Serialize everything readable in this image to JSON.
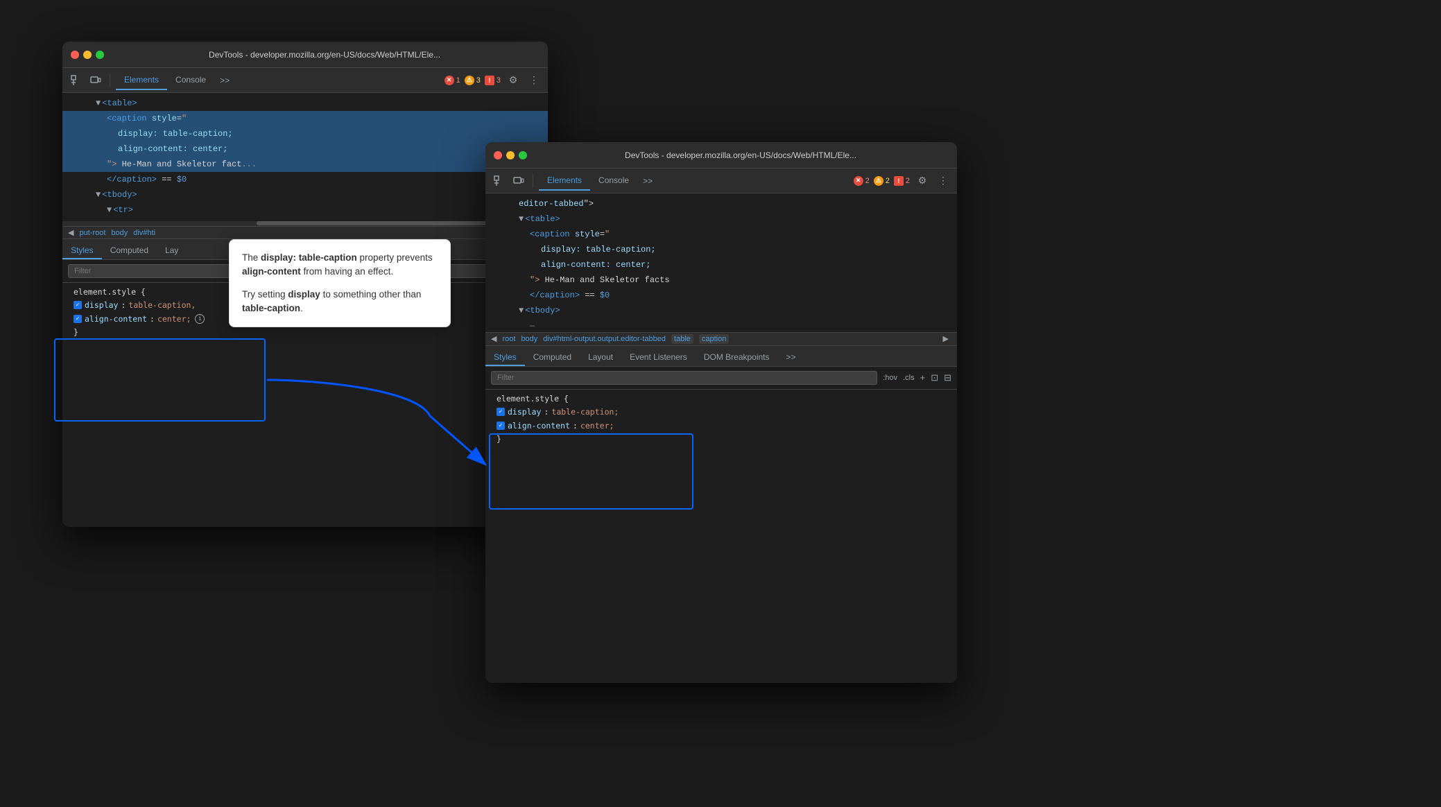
{
  "window1": {
    "title": "DevTools - developer.mozilla.org/en-US/docs/Web/HTML/Ele...",
    "tabs": [
      "Elements",
      "Console"
    ],
    "active_tab": "Elements",
    "badges": [
      {
        "type": "error",
        "count": "1"
      },
      {
        "type": "warning",
        "count": "3"
      },
      {
        "type": "info",
        "count": "3"
      }
    ],
    "html_lines": [
      {
        "indent": 2,
        "content": "▼<table>",
        "selected": false
      },
      {
        "indent": 3,
        "content": "<caption style=\"",
        "selected": true
      },
      {
        "indent": 4,
        "content": "display: table-caption;",
        "selected": true
      },
      {
        "indent": 4,
        "content": "align-content: center;",
        "selected": true
      },
      {
        "indent": 3,
        "content": "\"> He-Man and Skeletor facts",
        "selected": true
      },
      {
        "indent": 3,
        "content": "</caption> == $0",
        "selected": false
      },
      {
        "indent": 2,
        "content": "▼<tbody>",
        "selected": false
      },
      {
        "indent": 3,
        "content": "▼<tr>",
        "selected": false
      }
    ],
    "breadcrumb": [
      "◀",
      "put-root",
      "body",
      "div#hti"
    ],
    "styles_tabs": [
      "Styles",
      "Computed",
      "Lay"
    ],
    "filter_placeholder": "Filter",
    "css_rule": {
      "selector": "element.style {",
      "properties": [
        {
          "checked": true,
          "prop": "display",
          "value": "table-caption,"
        },
        {
          "checked": true,
          "prop": "align-content",
          "value": "center;"
        }
      ],
      "close": "}"
    }
  },
  "window2": {
    "title": "DevTools - developer.mozilla.org/en-US/docs/Web/HTML/Ele...",
    "tabs": [
      "Elements",
      "Console"
    ],
    "active_tab": "Elements",
    "badges": [
      {
        "type": "error",
        "count": "2"
      },
      {
        "type": "warning",
        "count": "2"
      },
      {
        "type": "info",
        "count": "2"
      }
    ],
    "html_lines": [
      {
        "indent": 2,
        "content": "editor-tabbed\">"
      },
      {
        "indent": 2,
        "content": "▼<table>"
      },
      {
        "indent": 3,
        "content": "<caption style=\""
      },
      {
        "indent": 4,
        "content": "display: table-caption;"
      },
      {
        "indent": 4,
        "content": "align-content: center;"
      },
      {
        "indent": 3,
        "content": "\"> He-Man and Skeletor facts"
      },
      {
        "indent": 3,
        "content": "</caption> == $0"
      },
      {
        "indent": 2,
        "content": "▼<tbody>"
      },
      {
        "indent": 3,
        "content": "—"
      }
    ],
    "breadcrumb": [
      "◀",
      "root",
      "body",
      "div#html-output.output.editor-tabbed",
      "table",
      "caption"
    ],
    "styles_tabs": [
      "Styles",
      "Computed",
      "Layout",
      "Event Listeners",
      "DOM Breakpoints",
      ">>"
    ],
    "active_styles_tab": "Styles",
    "filter_placeholder": "Filter",
    "filter_toolbar": [
      ":hov",
      ".cls",
      "+",
      "⊡",
      "⊟"
    ],
    "css_rule": {
      "selector": "element.style {",
      "properties": [
        {
          "checked": true,
          "prop": "display",
          "value": "table-caption;"
        },
        {
          "checked": true,
          "prop": "align-content",
          "value": "center;"
        }
      ],
      "close": "}"
    }
  },
  "tooltip": {
    "text1_before": "The ",
    "text1_bold1": "display: table-caption",
    "text1_after": " property prevents ",
    "text1_bold2": "align-content",
    "text1_end": " from having an effect.",
    "text2_before": "Try setting ",
    "text2_bold": "display",
    "text2_after": " to something other than ",
    "text2_bold2": "table-caption",
    "text2_end": "."
  }
}
